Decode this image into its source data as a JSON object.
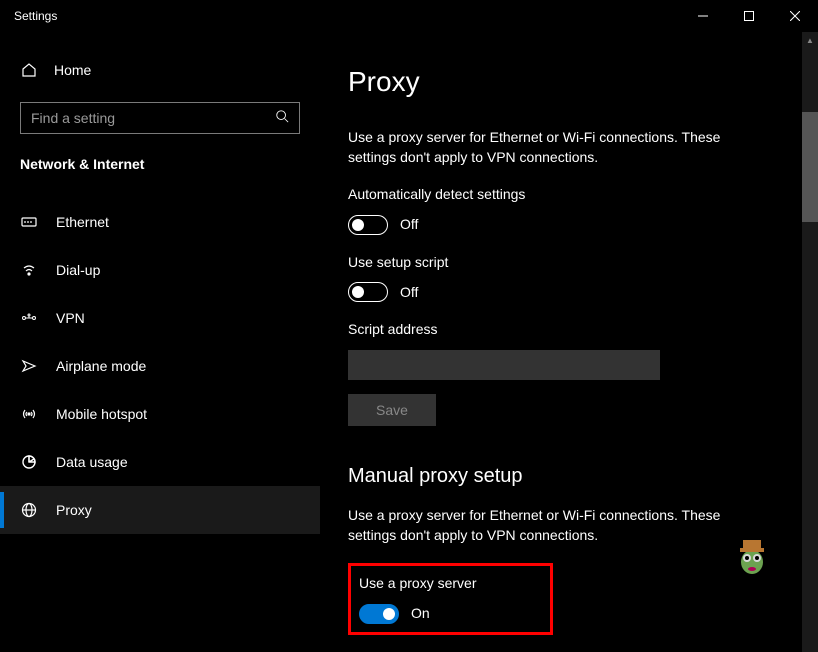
{
  "window": {
    "title": "Settings"
  },
  "sidebar": {
    "home": "Home",
    "search_placeholder": "Find a setting",
    "category": "Network & Internet",
    "items": [
      {
        "icon": "ethernet",
        "label": "Ethernet"
      },
      {
        "icon": "dialup",
        "label": "Dial-up"
      },
      {
        "icon": "vpn",
        "label": "VPN"
      },
      {
        "icon": "airplane",
        "label": "Airplane mode"
      },
      {
        "icon": "hotspot",
        "label": "Mobile hotspot"
      },
      {
        "icon": "data",
        "label": "Data usage"
      },
      {
        "icon": "proxy",
        "label": "Proxy"
      }
    ]
  },
  "page": {
    "title": "Proxy",
    "desc1": "Use a proxy server for Ethernet or Wi-Fi connections. These settings don't apply to VPN connections.",
    "auto_detect_label": "Automatically detect settings",
    "auto_detect_state": "Off",
    "use_script_label": "Use setup script",
    "use_script_state": "Off",
    "script_address_label": "Script address",
    "script_address_value": "",
    "save_label": "Save",
    "manual_header": "Manual proxy setup",
    "desc2": "Use a proxy server for Ethernet or Wi-Fi connections. These settings don't apply to VPN connections.",
    "use_proxy_label": "Use a proxy server",
    "use_proxy_state": "On"
  }
}
